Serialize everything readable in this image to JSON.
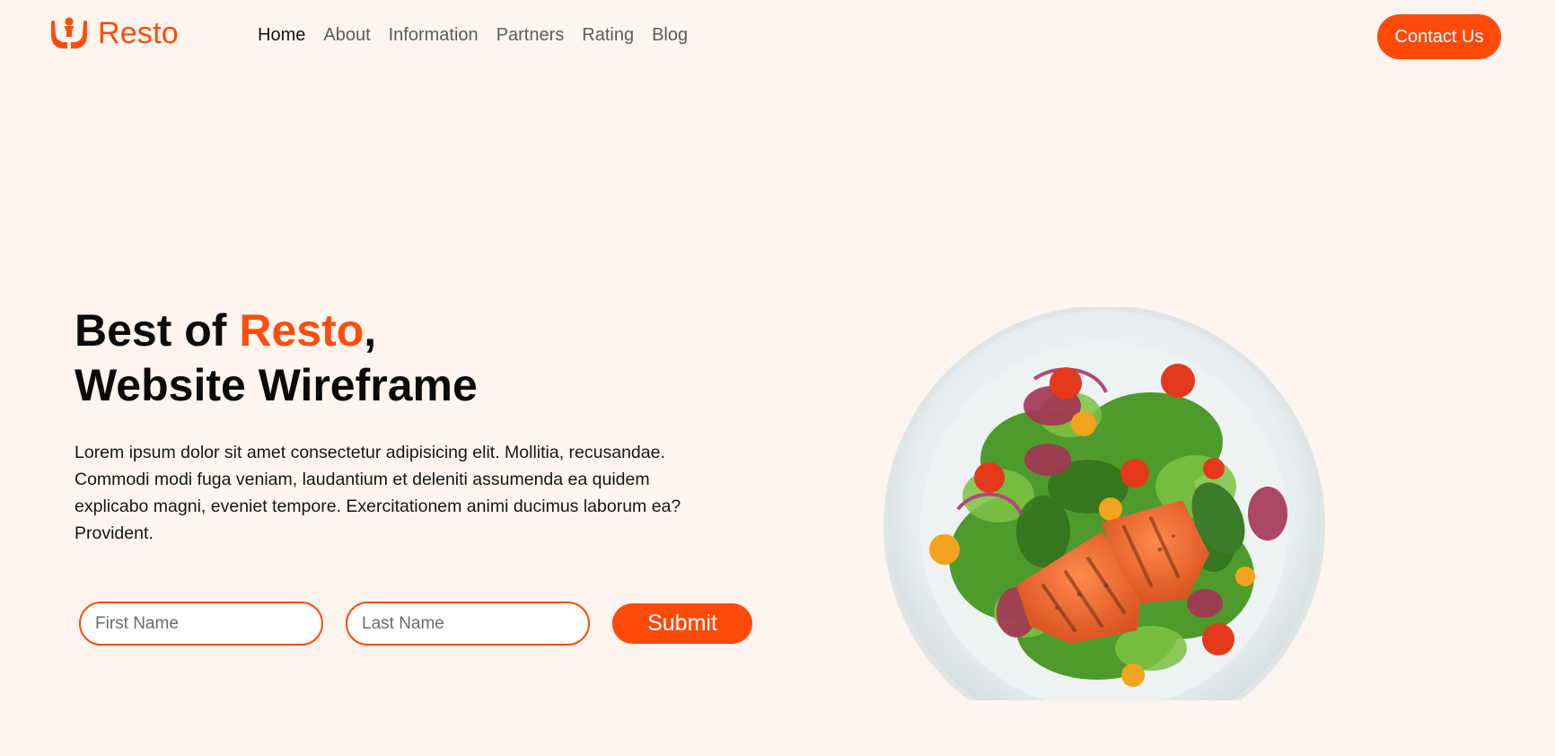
{
  "brand": {
    "name": "Resto",
    "accent_color": "#ff4d0d",
    "logo_icon": "hands-holding-person-icon"
  },
  "nav": {
    "items": [
      {
        "label": "Home",
        "active": true
      },
      {
        "label": "About",
        "active": false
      },
      {
        "label": "Information",
        "active": false
      },
      {
        "label": "Partners",
        "active": false
      },
      {
        "label": "Rating",
        "active": false
      },
      {
        "label": "Blog",
        "active": false
      }
    ],
    "contact_label": "Contact Us"
  },
  "hero": {
    "title_prefix": "Best of ",
    "title_accent": "Resto",
    "title_suffix": ",",
    "title_line2": "Website Wireframe",
    "description": "Lorem ipsum dolor sit amet consectetur adipisicing elit. Mollitia, recusandae. Commodi modi fuga veniam, laudantium et deleniti assumenda ea quidem explicabo magni, eveniet tempore. Exercitationem animi ducimus laborum ea? Provident."
  },
  "form": {
    "first_name_placeholder": "First Name",
    "last_name_placeholder": "Last Name",
    "first_name_value": "",
    "last_name_value": "",
    "submit_label": "Submit"
  },
  "image": {
    "subject": "salmon-salad-plate"
  },
  "colors": {
    "background": "#fef5ef",
    "primary": "#ff4a0a",
    "text": "#0b0b0b"
  }
}
